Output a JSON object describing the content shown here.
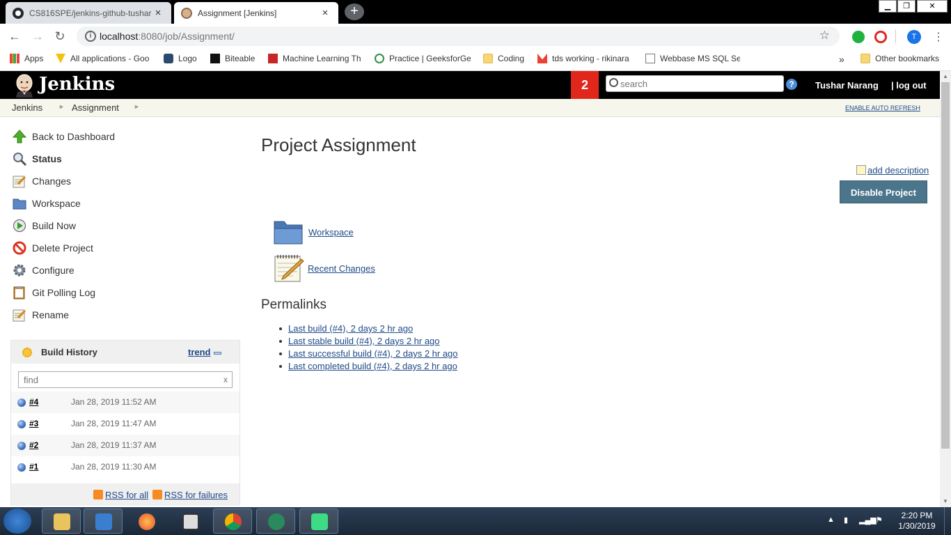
{
  "browser": {
    "tabs": [
      {
        "title": "CS816SPE/jenkins-github-tushar",
        "close": "×"
      },
      {
        "title": "Assignment [Jenkins]",
        "close": "×"
      }
    ],
    "new_tab": "+",
    "url_host": "localhost",
    "url_rest": ":8080/job/Assignment/",
    "profile_letter": "T",
    "bookmarks": [
      "Apps",
      "All applications - Goo",
      "Logo",
      "Biteable",
      "Machine Learning Th",
      "Practice | GeeksforGe",
      "Coding",
      "tds working - rikinara",
      "Webbase MS SQL Se"
    ],
    "bookmarks_more": "»",
    "other_bookmarks": "Other bookmarks"
  },
  "jenkins": {
    "brand": "Jenkins",
    "notification_count": "2",
    "search_placeholder": "search",
    "help": "?",
    "user": "Tushar Narang",
    "logout": "| log out",
    "breadcrumbs": [
      "Jenkins",
      "Assignment"
    ],
    "auto_refresh": "ENABLE AUTO REFRESH"
  },
  "sidebar": {
    "tasks": [
      {
        "label": "Back to Dashboard",
        "icon": "up-arrow-icon"
      },
      {
        "label": "Status",
        "icon": "magnifier-icon"
      },
      {
        "label": "Changes",
        "icon": "notepad-icon"
      },
      {
        "label": "Workspace",
        "icon": "folder-icon"
      },
      {
        "label": "Build Now",
        "icon": "clock-play-icon"
      },
      {
        "label": "Delete Project",
        "icon": "no-entry-icon"
      },
      {
        "label": "Configure",
        "icon": "gear-icon"
      },
      {
        "label": "Git Polling Log",
        "icon": "clipboard-icon"
      },
      {
        "label": "Rename",
        "icon": "notepad-icon"
      }
    ]
  },
  "build_history": {
    "title": "Build History",
    "trend": "trend",
    "find_placeholder": "find",
    "clear": "x",
    "builds": [
      {
        "number": "#4",
        "date": "Jan 28, 2019 11:52 AM"
      },
      {
        "number": "#3",
        "date": "Jan 28, 2019 11:47 AM"
      },
      {
        "number": "#2",
        "date": "Jan 28, 2019 11:37 AM"
      },
      {
        "number": "#1",
        "date": "Jan 28, 2019 11:30 AM"
      }
    ],
    "rss_all": "RSS for all",
    "rss_failures": "RSS for failures"
  },
  "main": {
    "title": "Project Assignment",
    "add_description": "add description",
    "disable_button": "Disable Project",
    "workspace_link": "Workspace",
    "recent_changes_link": "Recent Changes",
    "permalinks_title": "Permalinks",
    "permalinks": [
      "Last build (#4), 2 days 2 hr ago",
      "Last stable build (#4), 2 days 2 hr ago",
      "Last successful build (#4), 2 days 2 hr ago",
      "Last completed build (#4), 2 days 2 hr ago"
    ]
  },
  "taskbar": {
    "time": "2:20 PM",
    "date": "1/30/2019"
  },
  "colors": {
    "jenkins_header": "#000000",
    "badge": "#e1261c",
    "link": "#204a87",
    "disable_button": "#4b758b"
  }
}
